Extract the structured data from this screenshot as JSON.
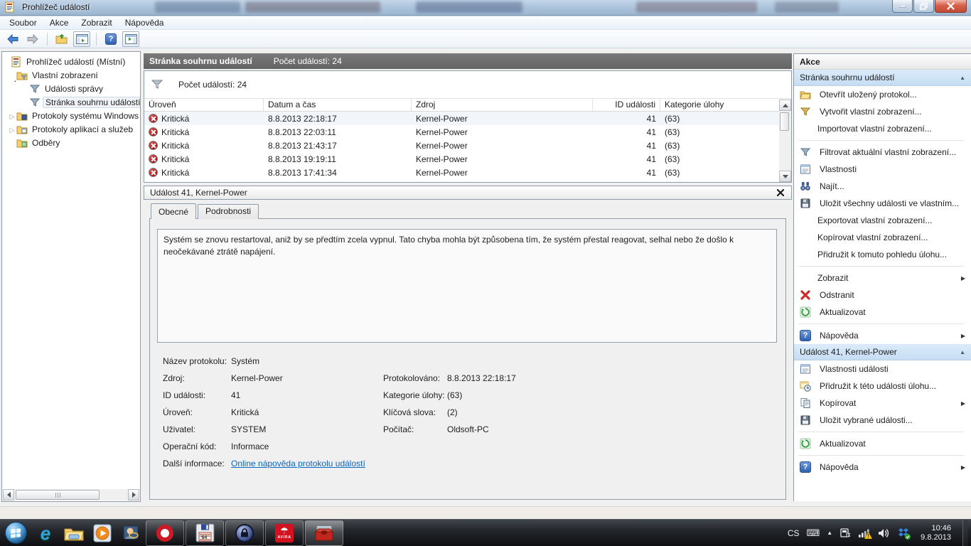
{
  "window": {
    "title": "Prohlížeč událostí",
    "menu": {
      "file": "Soubor",
      "action": "Akce",
      "view": "Zobrazit",
      "help": "Nápověda"
    }
  },
  "tree": {
    "root": "Prohlížeč událostí (Místní)",
    "custom_views": "Vlastní zobrazení",
    "admin_events": "Události správy",
    "summary_page": "Stránka souhrnu událostí",
    "windows_logs": "Protokoly systému Windows",
    "app_logs": "Protokoly aplikací a služeb",
    "subscriptions": "Odběry"
  },
  "summary": {
    "title": "Stránka souhrnu událostí",
    "count": "Počet událostí: 24",
    "filter_count": "Počet událostí: 24"
  },
  "table": {
    "col_level": "Úroveň",
    "col_datetime": "Datum a čas",
    "col_source": "Zdroj",
    "col_event_id": "ID události",
    "col_task": "Kategorie úlohy",
    "rows": [
      {
        "level": "Kritická",
        "datetime": "8.8.2013 22:18:17",
        "source": "Kernel-Power",
        "event_id": "41",
        "task": "(63)"
      },
      {
        "level": "Kritická",
        "datetime": "8.8.2013 22:03:11",
        "source": "Kernel-Power",
        "event_id": "41",
        "task": "(63)"
      },
      {
        "level": "Kritická",
        "datetime": "8.8.2013 21:43:17",
        "source": "Kernel-Power",
        "event_id": "41",
        "task": "(63)"
      },
      {
        "level": "Kritická",
        "datetime": "8.8.2013 19:19:11",
        "source": "Kernel-Power",
        "event_id": "41",
        "task": "(63)"
      },
      {
        "level": "Kritická",
        "datetime": "8.8.2013 17:41:34",
        "source": "Kernel-Power",
        "event_id": "41",
        "task": "(63)"
      }
    ]
  },
  "detail": {
    "title": "Událost 41, Kernel-Power",
    "tab_general": "Obecné",
    "tab_details": "Podrobnosti",
    "description": "Systém se znovu restartoval, aniž by se předtím zcela vypnul. Tato chyba mohla být způsobena tím, že systém přestal reagovat, selhal nebo že došlo k neočekávané ztrátě napájení.",
    "fields": {
      "log_name_label": "Název protokolu:",
      "log_name": "Systém",
      "source_label": "Zdroj:",
      "source": "Kernel-Power",
      "event_id_label": "ID události:",
      "event_id": "41",
      "level_label": "Úroveň:",
      "level": "Kritická",
      "user_label": "Uživatel:",
      "user": "SYSTEM",
      "opcode_label": "Operační kód:",
      "opcode": "Informace",
      "more_info_label": "Další informace:",
      "more_info_link": "Online nápověda protokolu událostí",
      "logged_label": "Protokolováno:",
      "logged": "8.8.2013 22:18:17",
      "task_label": "Kategorie úlohy:",
      "task": "(63)",
      "keywords_label": "Klíčová slova:",
      "keywords": "(2)",
      "computer_label": "Počítač:",
      "computer": "Oldsoft-PC"
    }
  },
  "actions": {
    "header": "Akce",
    "sec1_title": "Stránka souhrnu událostí",
    "open_saved": "Otevřít uložený protokol...",
    "create_view": "Vytvořit vlastní zobrazení...",
    "import_view": "Importovat vlastní zobrazení...",
    "filter_view": "Filtrovat aktuální vlastní zobrazení...",
    "properties": "Vlastnosti",
    "find": "Najít...",
    "save_all": "Uložit všechny události ve vlastním...",
    "export_view": "Exportovat vlastní zobrazení...",
    "copy_view": "Kopírovat vlastní zobrazení...",
    "attach_task_view": "Přidružit k tomuto pohledu úlohu...",
    "view": "Zobrazit",
    "remove": "Odstranit",
    "refresh": "Aktualizovat",
    "help": "Nápověda",
    "sec2_title": "Událost 41, Kernel-Power",
    "ev_properties": "Vlastnosti události",
    "ev_attach_task": "Přidružit k této události úlohu...",
    "ev_copy": "Kopírovat",
    "ev_save": "Uložit vybrané události...",
    "ev_refresh": "Aktualizovat",
    "ev_help": "Nápověda"
  },
  "taskbar": {
    "lang": "CS",
    "time": "10:46",
    "date": "9.8.2013",
    "avira_label": "AVIRA",
    "floppy_label": "64"
  },
  "icons": {
    "help_q": "?",
    "submenu": "▶",
    "collapse": "▲",
    "tree_collapsed": "▷",
    "keyboard": "⌨",
    "tray_expand": "▲",
    "umbrella": "☂",
    "ie": "e",
    "play": "▶"
  }
}
